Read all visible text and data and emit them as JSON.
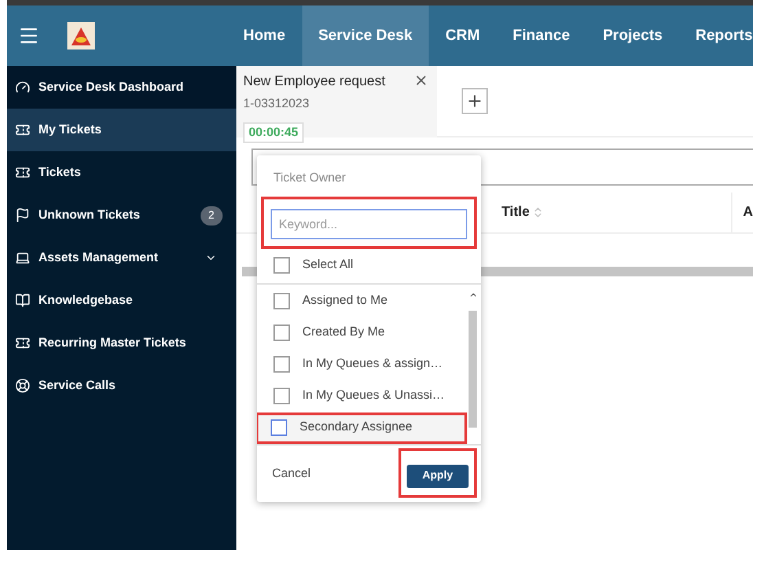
{
  "nav": [
    {
      "label": "Home",
      "selected": false
    },
    {
      "label": "Service Desk",
      "selected": true
    },
    {
      "label": "CRM",
      "selected": false
    },
    {
      "label": "Finance",
      "selected": false
    },
    {
      "label": "Projects",
      "selected": false
    },
    {
      "label": "Reports",
      "selected": false
    }
  ],
  "sidebar": {
    "items": [
      {
        "label": "Service Desk Dashboard",
        "kind": "dashboard",
        "selected": false
      },
      {
        "label": "My Tickets",
        "kind": "ticket",
        "selected": true
      },
      {
        "label": "Tickets",
        "kind": "ticket",
        "selected": false
      },
      {
        "label": "Unknown Tickets",
        "kind": "flag",
        "selected": false,
        "badge": "2"
      },
      {
        "label": "Assets Management",
        "kind": "laptop",
        "selected": false,
        "expandable": true
      },
      {
        "label": "Knowledgebase",
        "kind": "book",
        "selected": false
      },
      {
        "label": "Recurring Master Tickets",
        "kind": "ticket",
        "selected": false
      },
      {
        "label": "Service Calls",
        "kind": "lifebuoy",
        "selected": false
      }
    ]
  },
  "open_tab": {
    "title": "New Employee request",
    "number": "1-03312023",
    "timer": "00:00:45"
  },
  "table": {
    "columns": [
      "Title",
      "A"
    ]
  },
  "filter_popup": {
    "title": "Ticket Owner",
    "keyword": {
      "placeholder": "Keyword...",
      "highlighted": true
    },
    "select_all": {
      "label": "Select All",
      "checked": false
    },
    "options": [
      {
        "label": "Assigned to Me",
        "checked": false,
        "highlighted": false
      },
      {
        "label": "Created By Me",
        "checked": false,
        "highlighted": false
      },
      {
        "label": "In My Queues & assign…",
        "checked": false,
        "highlighted": false
      },
      {
        "label": "In My Queues & Unassi…",
        "checked": false,
        "highlighted": false
      },
      {
        "label": "Secondary Assignee",
        "checked": false,
        "highlighted": true
      }
    ],
    "cancel": "Cancel",
    "apply": {
      "label": "Apply",
      "highlighted": true
    }
  }
}
